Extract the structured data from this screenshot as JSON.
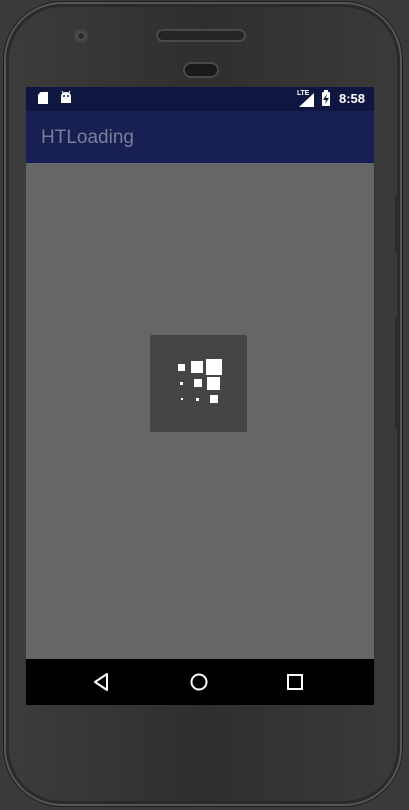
{
  "status_bar": {
    "network_label": "LTE",
    "time": "8:58",
    "icons": [
      "sd-card-icon",
      "android-icon",
      "signal-icon",
      "battery-charging-icon"
    ]
  },
  "app_bar": {
    "title": "HTLoading"
  },
  "loading_indicator": {
    "icon": "loading-grid-icon"
  },
  "nav_bar": {
    "buttons": [
      "back-icon",
      "home-icon",
      "recents-icon"
    ]
  },
  "colors": {
    "status_bar": "#0f1640",
    "app_bar": "#181f52",
    "app_title": "#7a7f97",
    "content_background": "#666666",
    "loading_box": "#454545",
    "nav_bar": "#000000"
  }
}
